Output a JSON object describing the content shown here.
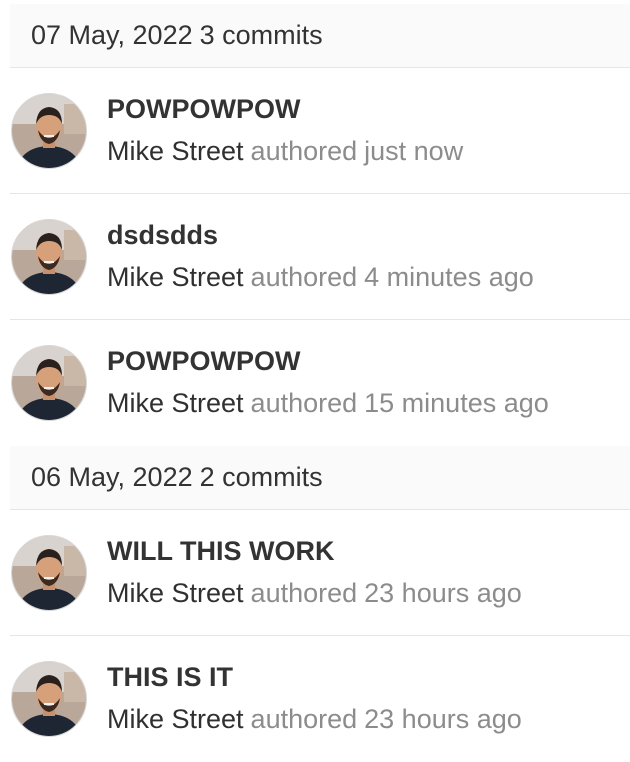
{
  "groups": [
    {
      "date": "07 May, 2022",
      "count": "3 commits",
      "commits": [
        {
          "title": "POWPOWPOW",
          "author": "Mike Street",
          "authored": "authored",
          "time": "just now"
        },
        {
          "title": "dsdsdds",
          "author": "Mike Street",
          "authored": "authored",
          "time": "4 minutes ago"
        },
        {
          "title": "POWPOWPOW",
          "author": "Mike Street",
          "authored": "authored",
          "time": "15 minutes ago"
        }
      ]
    },
    {
      "date": "06 May, 2022",
      "count": "2 commits",
      "commits": [
        {
          "title": "WILL THIS WORK",
          "author": "Mike Street",
          "authored": "authored",
          "time": "23 hours ago"
        },
        {
          "title": "THIS IS IT",
          "author": "Mike Street",
          "authored": "authored",
          "time": "23 hours ago"
        }
      ]
    }
  ],
  "colors": {
    "header_bg": "#fafafa",
    "divider": "#e6e6e6",
    "title_text": "#333333",
    "muted_text": "#8c8c8c"
  },
  "icons": {
    "avatar": "user-avatar-photo"
  }
}
